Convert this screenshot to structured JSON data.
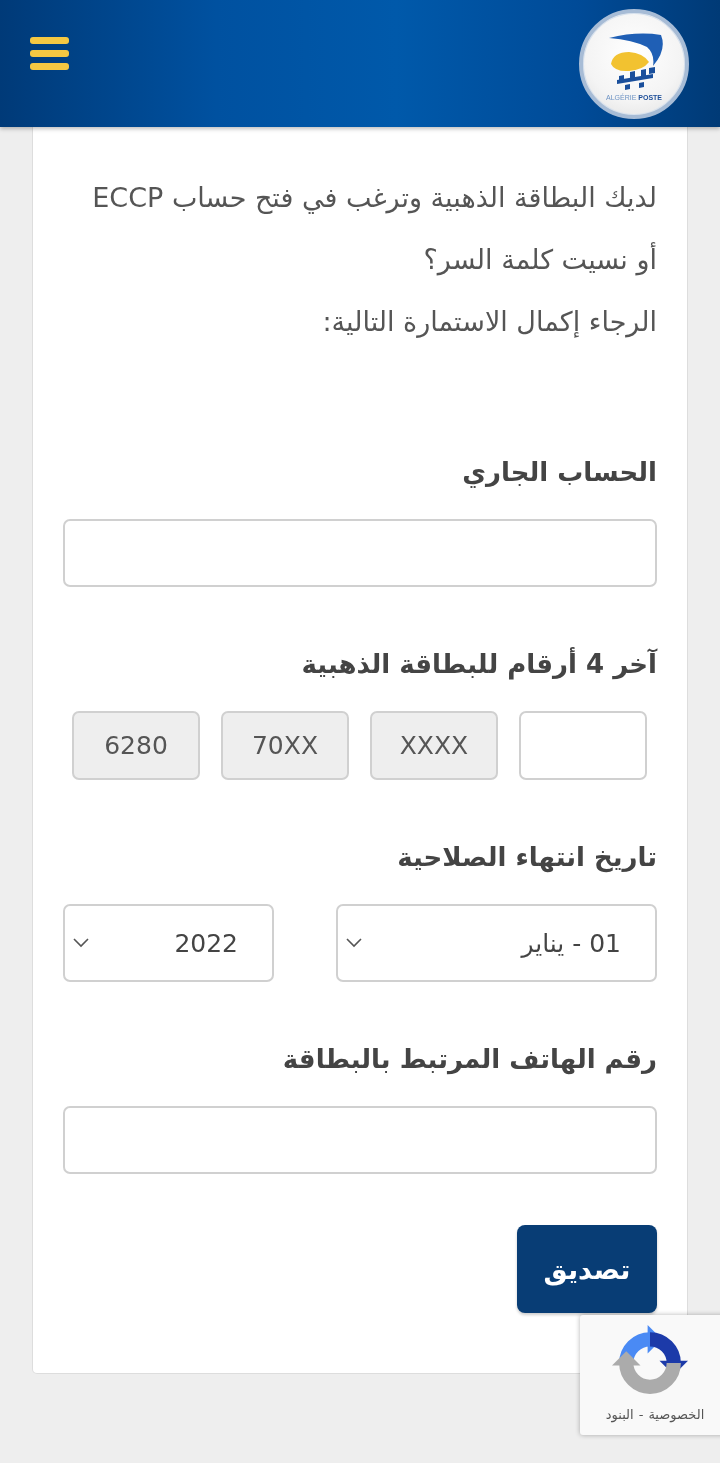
{
  "header": {
    "logo_text": "ALGÉRIE **POSTE**"
  },
  "intro": {
    "lines": [
      "لديك البطاقة الذهبية وترغب في فتح حساب ECCP",
      "أو نسيت كلمة السر؟"
    ],
    "instruction": "الرجاء إكمال الاستمارة التالية:"
  },
  "form": {
    "fields": [
      {
        "kind": "text",
        "label": "الحساب الجاري"
      },
      {
        "kind": "digits",
        "label": "آخر 4 أرقام للبطاقة الذهبية",
        "boxes": [
          {
            "disabled": false
          },
          {
            "value": "XXXX",
            "disabled": true
          },
          {
            "value": "70XX",
            "disabled": true
          },
          {
            "value": "6280",
            "disabled": true
          }
        ]
      },
      {
        "kind": "selects",
        "label": "تاريخ انتهاء الصلاحية",
        "selects": [
          {
            "value": "01 - يناير"
          },
          {
            "value": "2022"
          }
        ]
      },
      {
        "kind": "text",
        "label": "رقم الهاتف المرتبط بالبطاقة"
      }
    ],
    "submit": "تصديق"
  },
  "recaptcha": {
    "links": [
      "الخصوصية",
      "البنود"
    ],
    "separator": "-"
  }
}
